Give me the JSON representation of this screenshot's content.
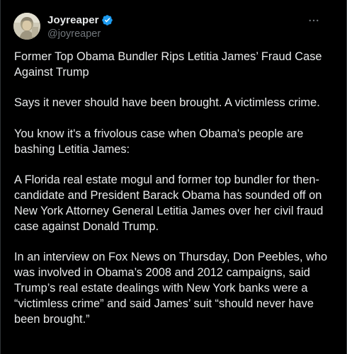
{
  "author": {
    "display_name": "Joyreaper",
    "handle": "@joyreaper",
    "verified": true,
    "verified_icon": "verified-badge-icon",
    "avatar_icon": "avatar-image"
  },
  "menu": {
    "more_icon": "more-options-icon"
  },
  "tweet": {
    "paragraphs": [
      "Former Top Obama Bundler Rips Letitia James’ Fraud Case Against Trump",
      "Says it never should have been brought.  A victimless crime.",
      "You know it's a frivolous case when Obama's people are bashing Letitia James:",
      "A Florida real estate mogul and former top bundler for then-candidate and President Barack Obama has sounded off on New York Attorney General Letitia James over her civil fraud case against Donald Trump.",
      "In an interview on Fox News on Thursday, Don Peebles, who was involved in Obama’s 2008 and 2012 campaigns, said Trump’s real estate dealings with New York banks were a “victimless crime” and said James’ suit “should never have been brought.”"
    ]
  },
  "colors": {
    "background": "#000000",
    "text_primary": "#e7e9ea",
    "text_secondary": "#71767b",
    "verified_blue": "#1d9bf0",
    "border": "#2f3336"
  }
}
